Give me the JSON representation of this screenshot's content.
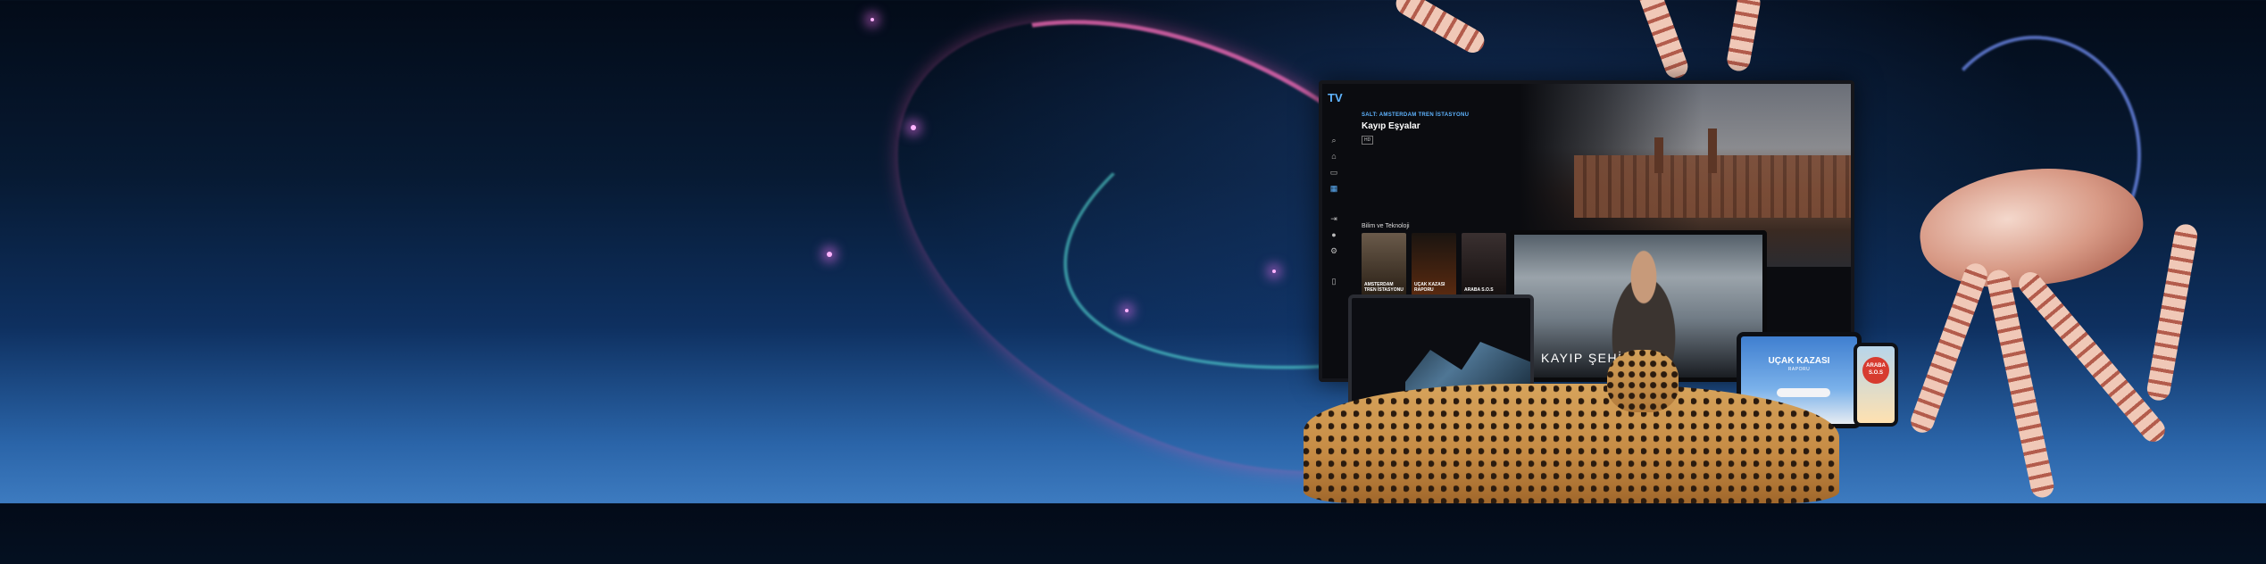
{
  "tv": {
    "logo": "TV",
    "kicker": "SALT: AMSTERDAM TREN İSTASYONU",
    "title": "Kayıp Eşyalar",
    "badge": "HD",
    "section_title": "Bilim ve Teknoloji",
    "thumbnails": [
      {
        "label": "AMSTERDAM TREN İSTASYONU"
      },
      {
        "label": "UÇAK KAZASI RAPORU"
      },
      {
        "label": "ARABA S.O.S"
      }
    ],
    "sidebar_icons": [
      "search-icon",
      "home-icon",
      "tv-icon",
      "grid-icon",
      "logout-icon",
      "bell-icon",
      "settings-icon",
      "book-icon"
    ]
  },
  "monitor": {
    "label": "KAYIP ŞEHİRLER"
  },
  "tablet": {
    "title": "UÇAK KAZASI",
    "subtitle": "RAPORU"
  },
  "phone": {
    "badge": "ARABA S.O.S"
  },
  "colors": {
    "accent": "#5fb4ff",
    "bg_top": "#030b18",
    "bg_bottom": "#3d7bc0"
  }
}
